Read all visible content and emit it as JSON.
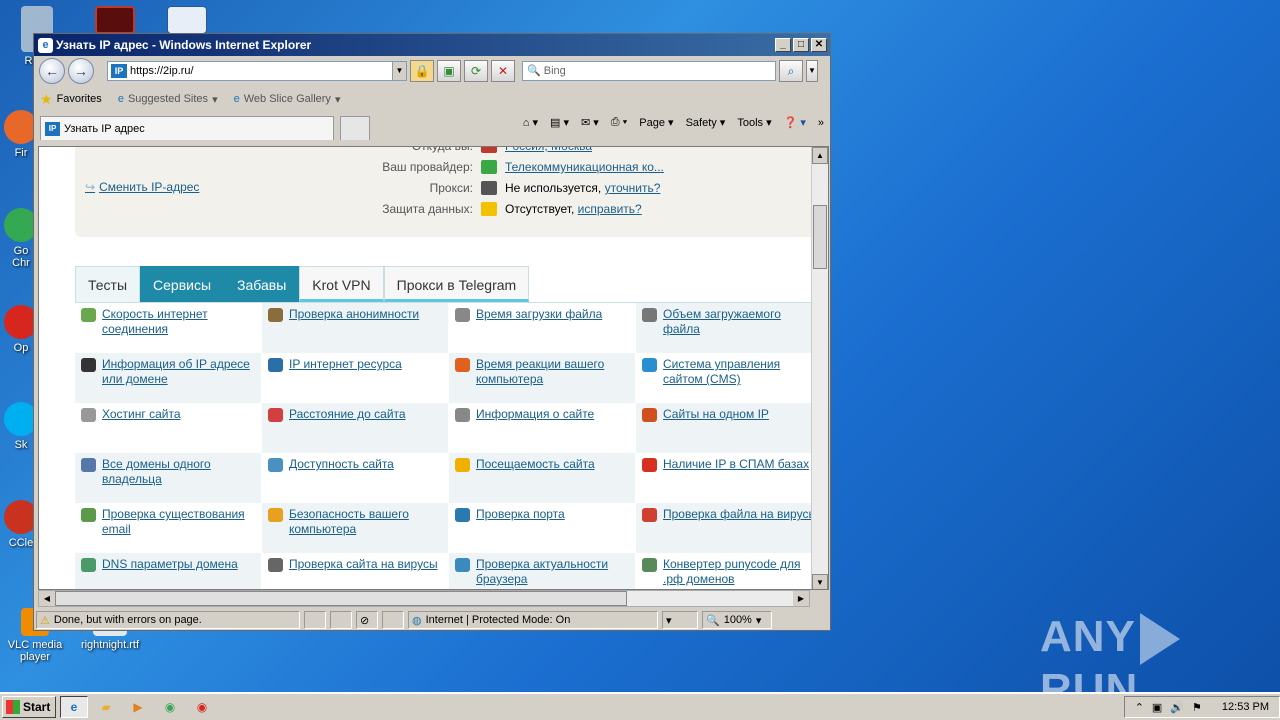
{
  "desktop": {
    "icons": [
      {
        "label": "Recy",
        "color": "#9fb8d0"
      },
      {
        "label": "Fir",
        "color": "#e8682a"
      },
      {
        "label": "Go\nChr",
        "color": "#34a853"
      },
      {
        "label": "Op",
        "color": "#d7261e"
      },
      {
        "label": "Sk",
        "color": "#00aff0"
      },
      {
        "label": "CCle",
        "color": "#c8321e"
      },
      {
        "label": "VLC media player",
        "color": "#f08c00"
      },
      {
        "label": "rightnight.rtf",
        "color": "#e0e8f0"
      }
    ],
    "watermark": "ANY  RUN"
  },
  "window": {
    "title": "Узнать IP адрес - Windows Internet Explorer",
    "address": "https://2ip.ru/",
    "search_placeholder": "Bing",
    "favorites_label": "Favorites",
    "suggested_sites": "Suggested Sites",
    "web_slice": "Web Slice Gallery",
    "tab_title": "Узнать IP адрес",
    "commands": [
      "Page",
      "Safety",
      "Tools"
    ]
  },
  "page": {
    "change_ip": "Сменить IP-адрес",
    "info_rows": [
      {
        "label": "Откуда вы:",
        "value": "Россия, Москва",
        "link": true,
        "icon_color": "#c0392b"
      },
      {
        "label": "Ваш провайдер:",
        "value": "Телекоммуникационная ко...",
        "link": true,
        "icon_color": "#3aa845"
      },
      {
        "label": "Прокси:",
        "value": "Не используется,",
        "extra_link": "уточнить?",
        "icon_color": "#555555"
      },
      {
        "label": "Защита данных:",
        "value": "Отсутствует,",
        "extra_link": "исправить?",
        "icon_color": "#f2c200"
      }
    ],
    "tabs": [
      "Тесты",
      "Сервисы",
      "Забавы",
      "Krot VPN",
      "Прокси в Telegram"
    ],
    "active_tab": 1,
    "services": [
      [
        {
          "text": "Скорость интернет соединения",
          "icon": "speed-icon",
          "color": "#6aa84f"
        },
        {
          "text": "Проверка анонимности",
          "icon": "anonymity-icon",
          "color": "#8a6d3b"
        },
        {
          "text": "Время загрузки файла",
          "icon": "clock-icon",
          "color": "#888888"
        },
        {
          "text": "Объем загружаемого файла",
          "icon": "file-size-icon",
          "color": "#777777"
        }
      ],
      [
        {
          "text": "Информация об IP адресе или домене",
          "icon": "ip-info-icon",
          "color": "#333333"
        },
        {
          "text": "IP интернет ресурса",
          "icon": "ip-resource-icon",
          "color": "#2a6fa8"
        },
        {
          "text": "Время реакции вашего компьютера",
          "icon": "reaction-icon",
          "color": "#e06020"
        },
        {
          "text": "Система управления сайтом (CMS)",
          "icon": "cms-icon",
          "color": "#2a8fd0"
        }
      ],
      [
        {
          "text": "Хостинг сайта",
          "icon": "hosting-icon",
          "color": "#999999"
        },
        {
          "text": "Расстояние до сайта",
          "icon": "pin-icon",
          "color": "#d04040"
        },
        {
          "text": "Информация о сайте",
          "icon": "site-info-icon",
          "color": "#888888"
        },
        {
          "text": "Сайты на одном IP",
          "icon": "same-ip-icon",
          "color": "#d05020"
        }
      ],
      [
        {
          "text": "Все домены одного владельца",
          "icon": "domains-icon",
          "color": "#5577aa"
        },
        {
          "text": "Доступность сайта",
          "icon": "availability-icon",
          "color": "#4a90c0"
        },
        {
          "text": "Посещаемость сайта",
          "icon": "star-icon",
          "color": "#f0b000"
        },
        {
          "text": "Наличие IP в СПАМ базах",
          "icon": "spam-icon",
          "color": "#d83020"
        }
      ],
      [
        {
          "text": "Проверка существования email",
          "icon": "email-icon",
          "color": "#5a9a4a"
        },
        {
          "text": "Безопасность вашего компьютера",
          "icon": "lock-icon",
          "color": "#e8a020"
        },
        {
          "text": "Проверка порта",
          "icon": "port-icon",
          "color": "#2a7ab0"
        },
        {
          "text": "Проверка файла на вирусы",
          "icon": "virus-file-icon",
          "color": "#d04030"
        }
      ],
      [
        {
          "text": "DNS параметры домена",
          "icon": "dns-icon",
          "color": "#4a9a6a"
        },
        {
          "text": "Проверка сайта на вирусы",
          "icon": "virus-site-icon",
          "color": "#666666"
        },
        {
          "text": "Проверка актуальности браузера",
          "icon": "browser-icon",
          "color": "#3a8ac0"
        },
        {
          "text": "Конвертер punycode для .рф доменов",
          "icon": "punycode-icon",
          "color": "#5a8a5a"
        }
      ]
    ]
  },
  "status": {
    "text": "Done, but with errors on page.",
    "zone": "Internet | Protected Mode: On",
    "zoom": "100%"
  },
  "taskbar": {
    "start": "Start",
    "clock": "12:53 PM"
  }
}
